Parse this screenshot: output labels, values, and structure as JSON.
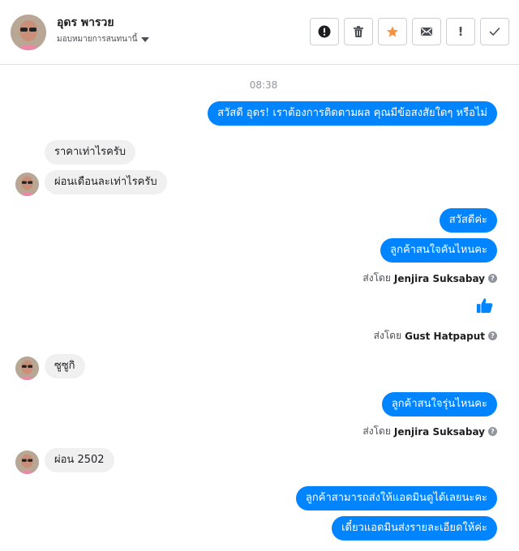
{
  "header": {
    "contact_name": "อุดร พารวย",
    "assign_label": "มอบหมายการสนทนานี้",
    "toolbar": [
      {
        "name": "report-button",
        "icon": "exclamation-circle-icon"
      },
      {
        "name": "delete-button",
        "icon": "trash-icon"
      },
      {
        "name": "star-button",
        "icon": "star-icon",
        "color": "#f7923b"
      },
      {
        "name": "mark-unread-button",
        "icon": "envelope-icon"
      },
      {
        "name": "important-button",
        "icon": "exclamation-icon"
      },
      {
        "name": "done-button",
        "icon": "checkmark-icon"
      }
    ]
  },
  "conversation": {
    "timestamp": "08:38",
    "messages": [
      {
        "from": "page",
        "text": "สวัสดี อุดร! เราต้องการติดตามผล คุณมีข้อสงสัยใดๆ หรือไม่"
      },
      {
        "from": "customer",
        "text": "ราคาเท่าไรครับ"
      },
      {
        "from": "customer",
        "text": "ผ่อนเดือนละเท่าไรครับ"
      },
      {
        "from": "page",
        "text": "สวัสดีค่ะ"
      },
      {
        "from": "page",
        "text": "ลูกค้าสนใจคันไหนคะ"
      },
      {
        "from": "page",
        "type": "like"
      },
      {
        "from": "customer",
        "text": "ซูซูกิ"
      },
      {
        "from": "page",
        "text": "ลูกค้าสนใจรุ่นไหนคะ"
      },
      {
        "from": "customer",
        "text": "ผ่อน 2502"
      },
      {
        "from": "page",
        "text": "ลูกค้าสามารถส่งให้แอดมินดูได้เลยนะคะ"
      },
      {
        "from": "page",
        "text": "เดี๋ยวแอดมินส่งรายละเอียดให้ค่ะ"
      }
    ],
    "sent_by_prefix": "ส่งโดย",
    "sent_by_names": [
      "Jenjira Suksabay",
      "Gust Hatpaput",
      "Jenjira Suksabay"
    ]
  },
  "colors": {
    "accent": "#0084ff",
    "incoming": "#f1f0f0",
    "like": "#0084ff"
  }
}
